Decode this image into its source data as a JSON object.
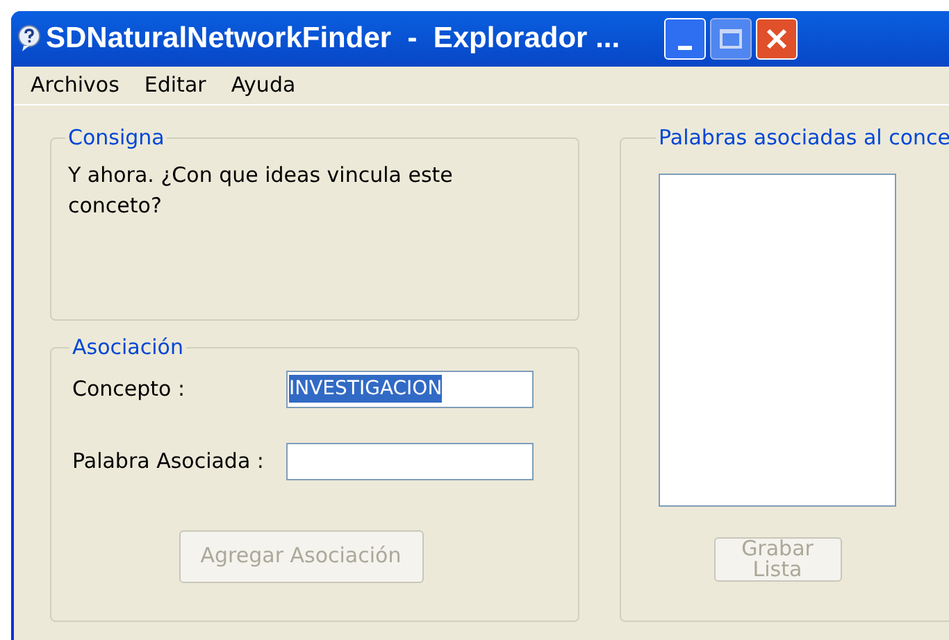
{
  "window": {
    "title": "SDNaturalNetworkFinder  -  Explorador ..."
  },
  "menu": [
    "Archivos",
    "Editar",
    "Ayuda"
  ],
  "consigna": {
    "legend": "Consigna",
    "text": "Y ahora. ¿Con que ideas vincula este conceto?"
  },
  "asociacion": {
    "legend": "Asociación",
    "fields": [
      {
        "label": "Concepto :",
        "value": "INVESTIGACION",
        "selected": true
      },
      {
        "label": "Palabra Asociada :"
      }
    ],
    "button": {
      "label": "Agregar Asociación",
      "disabled": true
    }
  },
  "word_list": {
    "legend": "Palabras asociadas al conce",
    "button": {
      "label": "Grabar Lista",
      "disabled": true
    }
  }
}
